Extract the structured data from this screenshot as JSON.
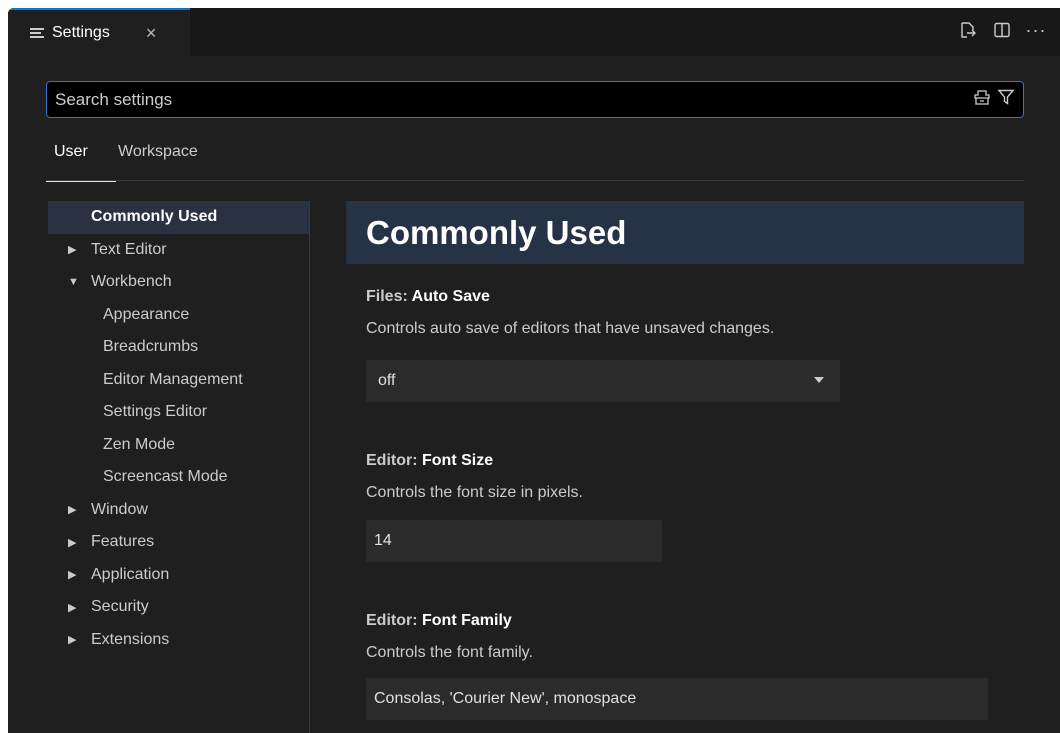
{
  "tab": {
    "icon": "settings-list-icon",
    "label": "Settings",
    "close": "×"
  },
  "actions": [
    {
      "name": "open-settings-json-icon"
    },
    {
      "name": "split-editor-icon"
    },
    {
      "name": "more-actions-icon",
      "glyph": "···"
    }
  ],
  "search": {
    "placeholder": "Search settings",
    "tools": [
      "clear-filter-icon",
      "filter-icon"
    ]
  },
  "scope_tabs": {
    "user": "User",
    "workspace": "Workspace"
  },
  "toc": [
    {
      "label": "Commonly Used",
      "level": 0,
      "selected": true
    },
    {
      "label": "Text Editor",
      "level": 0,
      "arrow": "▶"
    },
    {
      "label": "Workbench",
      "level": 0,
      "arrow": "▼"
    },
    {
      "label": "Appearance",
      "level": 1
    },
    {
      "label": "Breadcrumbs",
      "level": 1
    },
    {
      "label": "Editor Management",
      "level": 1
    },
    {
      "label": "Settings Editor",
      "level": 1
    },
    {
      "label": "Zen Mode",
      "level": 1
    },
    {
      "label": "Screencast Mode",
      "level": 1
    },
    {
      "label": "Window",
      "level": 0,
      "arrow": "▶"
    },
    {
      "label": "Features",
      "level": 0,
      "arrow": "▶"
    },
    {
      "label": "Application",
      "level": 0,
      "arrow": "▶"
    },
    {
      "label": "Security",
      "level": 0,
      "arrow": "▶"
    },
    {
      "label": "Extensions",
      "level": 0,
      "arrow": "▶"
    }
  ],
  "content": {
    "section_title": "Commonly Used",
    "settings": [
      {
        "category": "Files: ",
        "name": "Auto Save",
        "description": "Controls auto save of editors that have unsaved changes.",
        "control": "select",
        "value": "off"
      },
      {
        "category": "Editor: ",
        "name": "Font Size",
        "description": "Controls the font size in pixels.",
        "control": "text",
        "value": "14"
      },
      {
        "category": "Editor: ",
        "name": "Font Family",
        "description": "Controls the font family.",
        "control": "text",
        "value": "Consolas, 'Courier New', monospace"
      }
    ]
  },
  "colors": {
    "accent": "#0078d4",
    "search_border": "#3d72c9",
    "selected_toc": "#2a3140",
    "section_header": "#263245"
  }
}
